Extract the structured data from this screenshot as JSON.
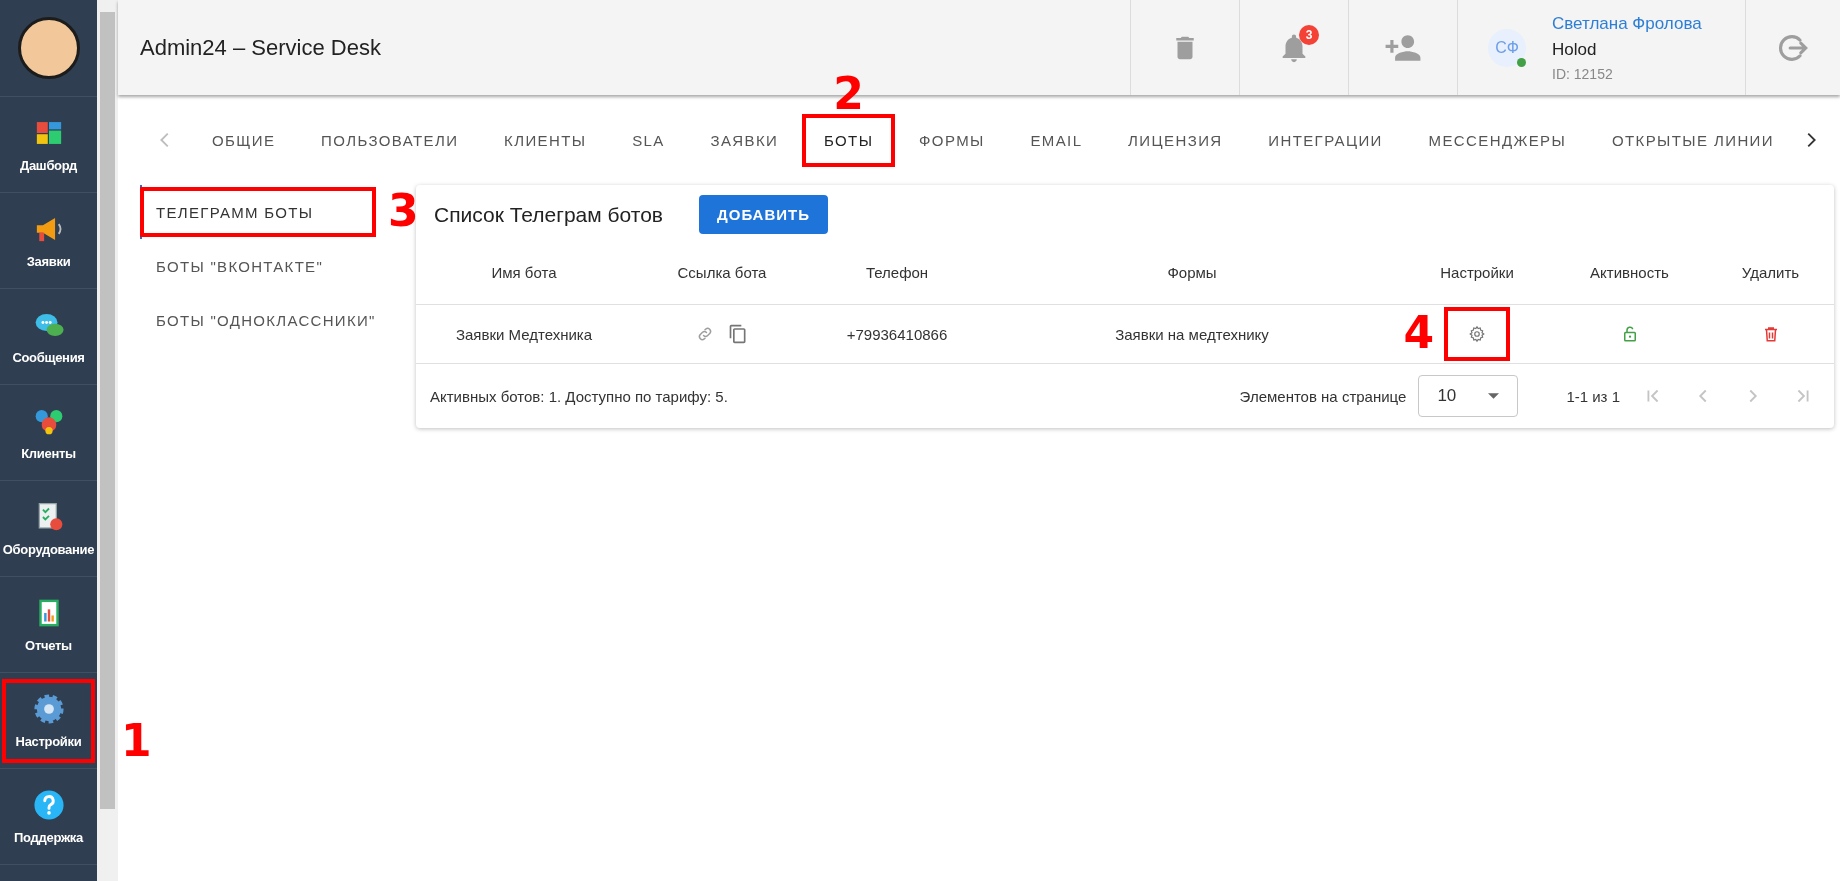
{
  "sidebar": {
    "items": [
      {
        "label": "Дашборд"
      },
      {
        "label": "Заявки"
      },
      {
        "label": "Сообщения"
      },
      {
        "label": "Клиенты"
      },
      {
        "label": "Оборудование"
      },
      {
        "label": "Отчеты"
      },
      {
        "label": "Настройки",
        "annotation": "1"
      },
      {
        "label": "Поддержка"
      }
    ]
  },
  "header": {
    "title": "Admin24 – Service Desk",
    "notifications": "3",
    "user": {
      "initials": "СФ",
      "online": true,
      "name": "Светлана Фролова",
      "company": "Holod",
      "id": "ID: 12152"
    }
  },
  "tabs": [
    {
      "label": "ОБЩИЕ",
      "selected": false
    },
    {
      "label": "ПОЛЬЗОВАТЕЛИ",
      "selected": false
    },
    {
      "label": "КЛИЕНТЫ",
      "selected": false
    },
    {
      "label": "SLA",
      "selected": false
    },
    {
      "label": "ЗАЯВКИ",
      "selected": false
    },
    {
      "label": "БОТЫ",
      "selected": true,
      "annotation": "2"
    },
    {
      "label": "ФОРМЫ",
      "selected": false
    },
    {
      "label": "EMAIL",
      "selected": false
    },
    {
      "label": "ЛИЦЕНЗИЯ",
      "selected": false
    },
    {
      "label": "ИНТЕГРАЦИИ",
      "selected": false
    },
    {
      "label": "МЕССЕНДЖЕРЫ",
      "selected": false
    },
    {
      "label": "ОТКРЫТЫЕ ЛИНИИ",
      "selected": false
    }
  ],
  "subnav": [
    {
      "label": "ТЕЛЕГРАММ БОТЫ",
      "selected": true,
      "annotation": "3"
    },
    {
      "label": "БОТЫ \"ВКОНТАКТЕ\"",
      "selected": false
    },
    {
      "label": "БОТЫ \"ОДНОКЛАССНИКИ\"",
      "selected": false
    }
  ],
  "card": {
    "title": "Список Телеграм ботов",
    "add_button": "ДОБАВИТЬ",
    "table": {
      "columns": [
        "Имя бота",
        "Ссылка бота",
        "Телефон",
        "Формы",
        "Настройки",
        "Активность",
        "Удалить"
      ],
      "rows": [
        {
          "name": "Заявки Медтехника",
          "phone": "+79936410866",
          "form": "Заявки на медтехнику",
          "active": true,
          "settings_annotation": "4"
        }
      ]
    },
    "footer": {
      "summary": "Активных ботов: 1. Доступно по тарифу: 5.",
      "per_page_label": "Элементов на странице",
      "per_page": "10",
      "range": "1-1 из 1"
    }
  }
}
